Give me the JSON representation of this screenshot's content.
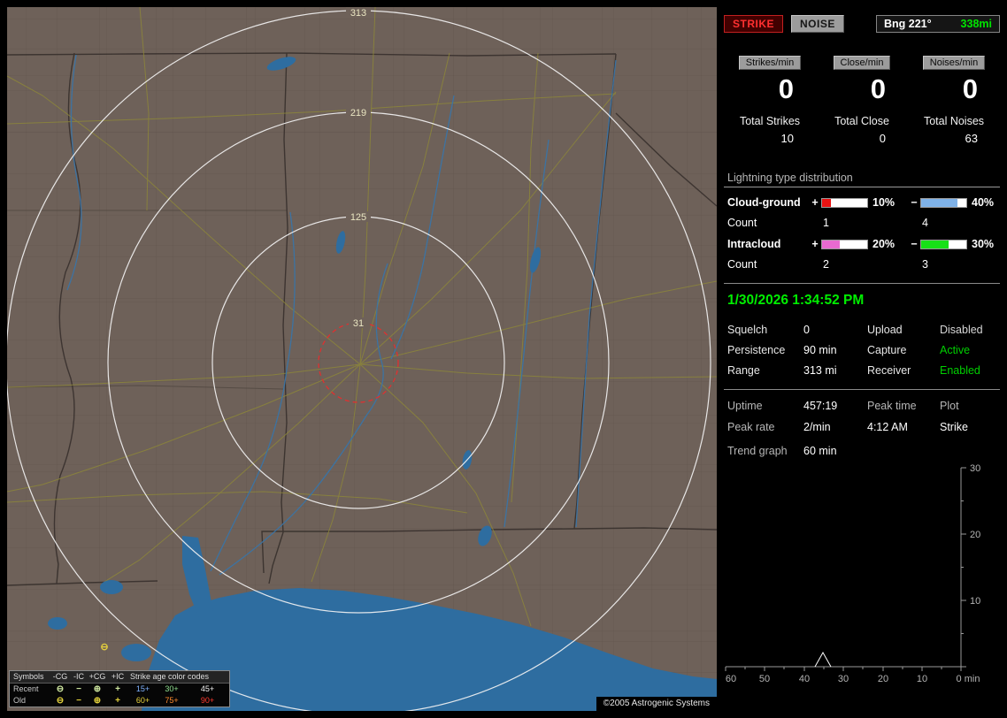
{
  "map": {
    "rings": [
      "313",
      "219",
      "125",
      "31"
    ],
    "strike": {
      "symbol": "⊖",
      "color": "#e3cf3d"
    },
    "copyright": "©2005 Astrogenic Systems",
    "legend": {
      "symbols_header": "Symbols",
      "symbol_cols": [
        "-CG",
        "-IC",
        "+CG",
        "+IC"
      ],
      "age_header": "Strike age color codes",
      "symbols": [
        "⊖",
        "−",
        "⊕",
        "+"
      ],
      "rows": [
        {
          "label": "Recent",
          "icon_color": "#cfe8a0",
          "ages": [
            {
              "t": "15+",
              "c": "#7fb2ff"
            },
            {
              "t": "30+",
              "c": "#8fe08f"
            },
            {
              "t": "45+",
              "c": "#f2f2f2"
            }
          ]
        },
        {
          "label": "Old",
          "icon_color": "#e3d23c",
          "ages": [
            {
              "t": "60+",
              "c": "#e8d33c"
            },
            {
              "t": "75+",
              "c": "#ff8c2e"
            },
            {
              "t": "90+",
              "c": "#ff3b30"
            }
          ]
        }
      ]
    }
  },
  "panel": {
    "strike_button": "STRIKE",
    "noise_button": "NOISE",
    "bearing_label": "Bng 221°",
    "bearing_value": "338mi",
    "bearing_value_color": "#00e400",
    "rate_columns": [
      {
        "header": "Strikes/min",
        "rate": "0",
        "total_label": "Total Strikes",
        "total_value": "10"
      },
      {
        "header": "Close/min",
        "rate": "0",
        "total_label": "Total Close",
        "total_value": "0"
      },
      {
        "header": "Noises/min",
        "rate": "0",
        "total_label": "Total Noises",
        "total_value": "63"
      }
    ],
    "distribution": {
      "title": "Lightning type distribution",
      "plus_sign": "+",
      "minus_sign": "−",
      "count_label": "Count",
      "rows": [
        {
          "label": "Cloud-ground",
          "pos_pct": 10,
          "pos_pct_text": "10%",
          "pos_color": "#e81212",
          "pos_count": "1",
          "neg_pct": 40,
          "neg_pct_text": "40%",
          "neg_color": "#7fb2e8",
          "neg_count": "4"
        },
        {
          "label": "Intracloud",
          "pos_pct": 20,
          "pos_pct_text": "20%",
          "pos_color": "#e86ad0",
          "pos_count": "2",
          "neg_pct": 30,
          "neg_pct_text": "30%",
          "neg_color": "#17e017",
          "neg_count": "3"
        }
      ]
    },
    "clock": "1/30/2026 1:34:52 PM",
    "clock_color": "#00ee00",
    "settings_rows": [
      {
        "l1": "Squelch",
        "v1": "0",
        "l2": "Upload",
        "v2": "Disabled",
        "v2_color": "#d6d6d6"
      },
      {
        "l1": "Persistence",
        "v1": "90 min",
        "l2": "Capture",
        "v2": "Active",
        "v2_color": "#00d000"
      },
      {
        "l1": "Range",
        "v1": "313 mi",
        "l2": "Receiver",
        "v2": "Enabled",
        "v2_color": "#00d000"
      }
    ],
    "stats": {
      "r1": [
        "Uptime",
        "457:19",
        "Peak time",
        "Plot"
      ],
      "r2": [
        "Peak rate",
        "2/min",
        "4:12 AM",
        "Strike"
      ]
    },
    "trend_label": "Trend graph",
    "trend_value": "60 min"
  },
  "chart_data": {
    "type": "line",
    "title": "Strike rate trend, last 60 minutes",
    "x_ticks": [
      "60",
      "50",
      "40",
      "30",
      "20",
      "10",
      "0 min"
    ],
    "y_ticks": [
      "30",
      "20",
      "10"
    ],
    "x_range_minutes_ago": [
      60,
      0
    ],
    "y_range": [
      0,
      30
    ],
    "series": [
      {
        "name": "Strike",
        "points_min_value": [
          [
            60,
            0
          ],
          [
            36,
            0
          ],
          [
            35,
            2
          ],
          [
            34,
            0
          ],
          [
            0,
            0
          ]
        ]
      }
    ],
    "grid": false,
    "axis_position": "right-bottom"
  }
}
